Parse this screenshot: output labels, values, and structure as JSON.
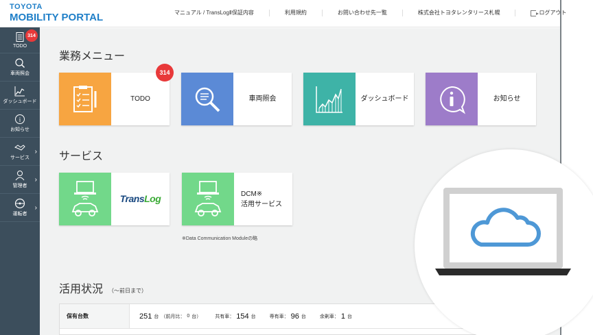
{
  "header": {
    "brand": "TOYOTA",
    "portal": "MOBILITY PORTAL",
    "links": [
      "マニュアル / TransLogⅡ保証内容",
      "利用規約",
      "お問い合わせ先一覧",
      "株式会社トヨタレンタリース札幌"
    ],
    "logout": "ログアウト"
  },
  "sidebar": {
    "items": [
      {
        "label": "TODO",
        "icon": "todo-icon",
        "badge": "314"
      },
      {
        "label": "車両照会",
        "icon": "search-icon"
      },
      {
        "label": "ダッシュボード",
        "icon": "chart-icon"
      },
      {
        "label": "お知らせ",
        "icon": "info-icon"
      },
      {
        "label": "サービス",
        "icon": "handshake-icon"
      },
      {
        "label": "管理者",
        "icon": "admin-icon"
      },
      {
        "label": "運転者",
        "icon": "steering-icon"
      }
    ]
  },
  "menu": {
    "title": "業務メニュー",
    "cards": [
      {
        "label": "TODO",
        "badge": "314",
        "color": "#f7a541"
      },
      {
        "label": "車両照会",
        "color": "#5b8ad6"
      },
      {
        "label": "ダッシュボード",
        "color": "#3eb3a7"
      },
      {
        "label": "お知らせ",
        "color": "#9d7cc9"
      }
    ]
  },
  "services": {
    "title": "サービス",
    "color": "#72d88a",
    "cards": [
      {
        "logo_a": "Trans",
        "logo_b": "Log"
      },
      {
        "line1": "DCM※",
        "line2": "活用サービス"
      }
    ],
    "note": "※Data Communication Moduleの略"
  },
  "status": {
    "title": "活用状況",
    "subtitle": "（～前日まで）",
    "row": {
      "head": "保有台数",
      "total": "251",
      "unit": "台",
      "prev": "（前月比：",
      "prev_val": "0",
      "prev_unit": "台）",
      "shared_label": "共有車：",
      "shared_val": "154",
      "dedicated_label": "専有車：",
      "dedicated_val": "96",
      "spare_label": "余剰車：",
      "spare_val": "1"
    }
  }
}
